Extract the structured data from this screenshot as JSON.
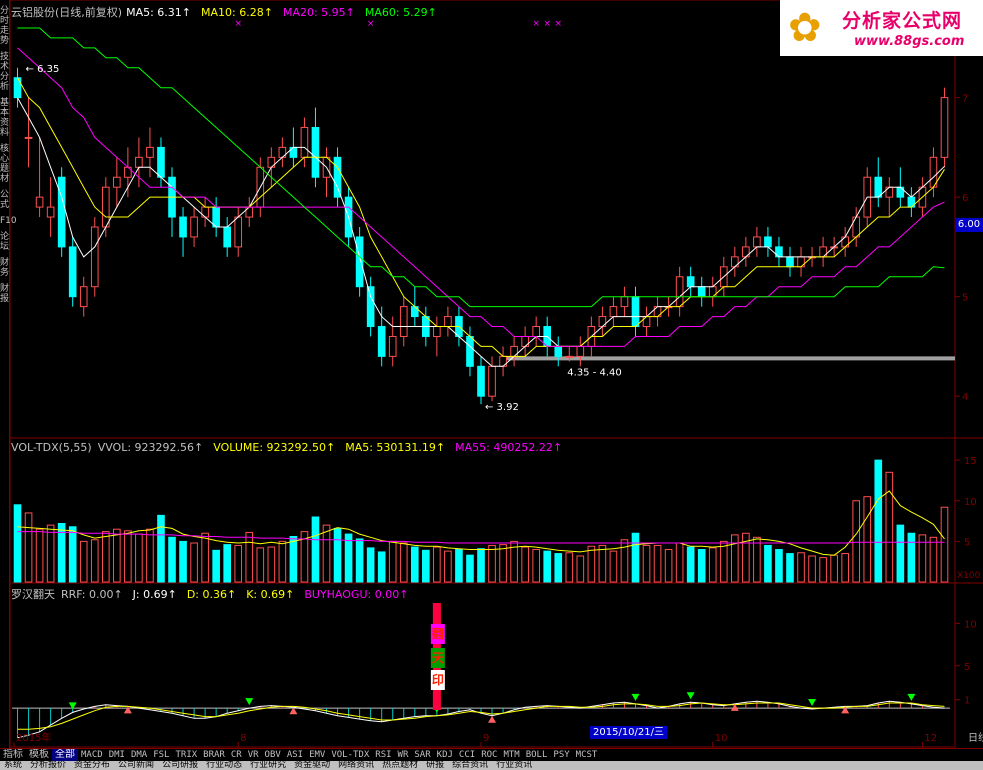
{
  "panels": {
    "main": {
      "stock_title": "云铝股份(日线,前复权)",
      "indicators": [
        {
          "label": "MA5: 6.31",
          "color": "#ffffff"
        },
        {
          "label": "MA10: 6.28",
          "color": "#ffff00"
        },
        {
          "label": "MA20: 5.95",
          "color": "#ff00ff"
        },
        {
          "label": "MA60: 5.29",
          "color": "#00ff00"
        }
      ],
      "price_tag": "6.00",
      "y_ticks": [
        "7",
        "6",
        "5",
        "4"
      ],
      "annotations": [
        "6.35",
        "3.92",
        "4.35 - 4.40"
      ]
    },
    "volume": {
      "name": "VOL-TDX(5,55)",
      "indicators": [
        {
          "label": "VVOL: 923292.56",
          "color": "#c0c0c0"
        },
        {
          "label": "VOLUME: 923292.50",
          "color": "#ffff00"
        },
        {
          "label": "MA5: 530131.19",
          "color": "#ffff00"
        },
        {
          "label": "MA55: 490252.22",
          "color": "#ff00ff"
        }
      ],
      "y_ticks": [
        "15",
        "10",
        "5"
      ],
      "unit": "X100"
    },
    "oscillator": {
      "name": "罗汉翻天",
      "indicators": [
        {
          "label": "RRF: 0.00",
          "color": "#c0c0c0"
        },
        {
          "label": "J: 0.69",
          "color": "#ffffff"
        },
        {
          "label": "D: 0.36",
          "color": "#ffff00"
        },
        {
          "label": "K: 0.69",
          "color": "#ffff00"
        },
        {
          "label": "BUYHAOGU: 0.00",
          "color": "#ff00ff"
        }
      ],
      "y_ticks": [
        "10",
        "5",
        "1"
      ],
      "signal_chars": [
        "翻",
        "天",
        "印"
      ]
    }
  },
  "x_axis_labels": [
    "2015年",
    "8",
    "9",
    "10",
    "12"
  ],
  "selected_date": "2015/10/21/三",
  "side_tabs": [
    "日线"
  ],
  "logo": {
    "name": "分析家公式网",
    "url": "www.88gs.com"
  },
  "tabs": [
    "指标",
    "模板",
    "全部",
    "MACD",
    "DMI",
    "DMA",
    "FSL",
    "TRIX",
    "BRAR",
    "CR",
    "VR",
    "OBV",
    "ASI",
    "EMV",
    "VOL-TDX",
    "RSI",
    "WR",
    "SAR",
    "KDJ",
    "CCI",
    "ROC",
    "MTM",
    "BOLL",
    "PSY",
    "MCST"
  ],
  "active_tab": "全部",
  "left_tabs": [
    "分时走势",
    "技术分析",
    "基本资料",
    "核心题材",
    "公式",
    "F10",
    "论坛",
    "财务",
    "财报"
  ],
  "bottom_items": [
    "系统",
    "分析报价",
    "资金分布",
    "公司新闻",
    "公司研报",
    "行业动态",
    "行业研究",
    "资金驱动",
    "网络资讯",
    "热点题材",
    "研报",
    "综合资讯",
    "行业资讯"
  ],
  "chart_data": {
    "type": "candlestick",
    "ylim": [
      3.6,
      7.8
    ],
    "x": [
      "2015-06",
      "",
      "",
      "",
      "",
      "",
      "",
      "",
      "",
      "",
      "",
      "",
      "",
      "",
      "",
      "",
      "",
      "",
      "",
      "",
      "",
      "",
      "",
      "",
      "",
      "",
      "",
      "",
      "",
      "",
      "",
      "",
      "",
      "",
      "",
      "",
      "",
      "",
      "",
      "",
      "",
      "",
      "",
      "",
      "",
      "",
      "",
      "",
      "",
      "",
      "",
      "",
      "",
      "",
      "",
      "",
      "",
      "",
      "",
      "",
      "",
      "",
      "",
      "",
      "",
      "",
      "",
      "",
      "",
      "",
      "",
      "",
      "",
      "",
      "",
      "",
      "",
      "",
      "",
      "",
      "",
      "",
      "",
      "",
      "",
      "",
      "",
      "",
      "",
      "",
      "",
      "",
      "",
      "",
      "",
      "",
      "",
      "",
      "",
      "",
      "2015-12"
    ],
    "ohlc": [
      [
        7.2,
        7.3,
        6.9,
        7.0
      ],
      [
        6.6,
        7.0,
        6.3,
        6.6
      ],
      [
        5.9,
        6.6,
        5.8,
        6.0
      ],
      [
        5.8,
        6.2,
        5.6,
        5.9
      ],
      [
        6.2,
        6.3,
        5.4,
        5.5
      ],
      [
        5.5,
        5.6,
        4.9,
        5.0
      ],
      [
        4.9,
        5.2,
        4.8,
        5.1
      ],
      [
        5.1,
        5.8,
        5.0,
        5.7
      ],
      [
        5.7,
        6.2,
        5.6,
        6.1
      ],
      [
        6.1,
        6.4,
        5.9,
        6.2
      ],
      [
        6.2,
        6.5,
        6.0,
        6.3
      ],
      [
        6.3,
        6.6,
        6.1,
        6.4
      ],
      [
        6.4,
        6.7,
        6.2,
        6.5
      ],
      [
        6.5,
        6.6,
        6.1,
        6.2
      ],
      [
        6.2,
        6.3,
        5.6,
        5.8
      ],
      [
        5.8,
        5.9,
        5.4,
        5.6
      ],
      [
        5.6,
        5.9,
        5.5,
        5.8
      ],
      [
        5.8,
        6.0,
        5.7,
        5.9
      ],
      [
        5.9,
        6.0,
        5.6,
        5.7
      ],
      [
        5.7,
        5.8,
        5.4,
        5.5
      ],
      [
        5.5,
        5.9,
        5.4,
        5.8
      ],
      [
        5.8,
        6.0,
        5.7,
        5.9
      ],
      [
        5.9,
        6.4,
        5.8,
        6.3
      ],
      [
        6.3,
        6.5,
        6.1,
        6.4
      ],
      [
        6.4,
        6.6,
        6.3,
        6.5
      ],
      [
        6.5,
        6.7,
        6.3,
        6.4
      ],
      [
        6.4,
        6.8,
        6.3,
        6.7
      ],
      [
        6.7,
        6.9,
        6.1,
        6.2
      ],
      [
        6.2,
        6.5,
        6.0,
        6.4
      ],
      [
        6.4,
        6.5,
        5.9,
        6.0
      ],
      [
        6.0,
        6.1,
        5.5,
        5.6
      ],
      [
        5.6,
        5.7,
        5.0,
        5.1
      ],
      [
        5.1,
        5.2,
        4.6,
        4.7
      ],
      [
        4.7,
        4.9,
        4.3,
        4.4
      ],
      [
        4.4,
        4.8,
        4.3,
        4.6
      ],
      [
        4.6,
        5.0,
        4.5,
        4.9
      ],
      [
        4.9,
        5.1,
        4.7,
        4.8
      ],
      [
        4.8,
        4.9,
        4.5,
        4.6
      ],
      [
        4.6,
        4.8,
        4.4,
        4.7
      ],
      [
        4.7,
        4.9,
        4.6,
        4.8
      ],
      [
        4.8,
        4.9,
        4.5,
        4.6
      ],
      [
        4.6,
        4.7,
        4.2,
        4.3
      ],
      [
        4.3,
        4.4,
        3.92,
        4.0
      ],
      [
        4.0,
        4.4,
        3.95,
        4.3
      ],
      [
        4.3,
        4.5,
        4.2,
        4.4
      ],
      [
        4.4,
        4.6,
        4.3,
        4.5
      ],
      [
        4.5,
        4.7,
        4.4,
        4.6
      ],
      [
        4.6,
        4.8,
        4.5,
        4.7
      ],
      [
        4.7,
        4.8,
        4.4,
        4.5
      ],
      [
        4.5,
        4.6,
        4.3,
        4.4
      ],
      [
        4.4,
        4.5,
        4.35,
        4.4
      ],
      [
        4.4,
        4.6,
        4.3,
        4.5
      ],
      [
        4.5,
        4.8,
        4.4,
        4.7
      ],
      [
        4.7,
        4.9,
        4.6,
        4.8
      ],
      [
        4.8,
        5.0,
        4.7,
        4.9
      ],
      [
        4.9,
        5.1,
        4.8,
        5.0
      ],
      [
        5.0,
        5.1,
        4.6,
        4.7
      ],
      [
        4.7,
        4.9,
        4.6,
        4.8
      ],
      [
        4.8,
        5.0,
        4.7,
        4.9
      ],
      [
        4.9,
        5.0,
        4.8,
        4.9
      ],
      [
        4.9,
        5.3,
        4.8,
        5.2
      ],
      [
        5.2,
        5.3,
        5.0,
        5.1
      ],
      [
        5.1,
        5.2,
        4.9,
        5.0
      ],
      [
        5.0,
        5.2,
        4.9,
        5.1
      ],
      [
        5.1,
        5.4,
        5.0,
        5.3
      ],
      [
        5.3,
        5.5,
        5.2,
        5.4
      ],
      [
        5.4,
        5.6,
        5.3,
        5.5
      ],
      [
        5.5,
        5.7,
        5.4,
        5.6
      ],
      [
        5.6,
        5.7,
        5.4,
        5.5
      ],
      [
        5.5,
        5.6,
        5.3,
        5.4
      ],
      [
        5.4,
        5.5,
        5.2,
        5.3
      ],
      [
        5.3,
        5.5,
        5.2,
        5.4
      ],
      [
        5.4,
        5.5,
        5.3,
        5.4
      ],
      [
        5.4,
        5.6,
        5.3,
        5.5
      ],
      [
        5.5,
        5.6,
        5.4,
        5.5
      ],
      [
        5.5,
        5.7,
        5.4,
        5.6
      ],
      [
        5.6,
        5.9,
        5.5,
        5.8
      ],
      [
        5.8,
        6.3,
        5.7,
        6.2
      ],
      [
        6.2,
        6.4,
        5.9,
        6.0
      ],
      [
        6.0,
        6.2,
        5.8,
        6.1
      ],
      [
        6.1,
        6.3,
        5.9,
        6.0
      ],
      [
        6.0,
        6.1,
        5.8,
        5.9
      ],
      [
        5.9,
        6.2,
        5.8,
        6.1
      ],
      [
        6.1,
        6.5,
        6.0,
        6.4
      ],
      [
        6.4,
        7.1,
        6.3,
        7.0
      ]
    ],
    "ma5": [
      7.0,
      6.8,
      6.6,
      6.3,
      6.0,
      5.6,
      5.4,
      5.5,
      5.7,
      5.9,
      6.1,
      6.3,
      6.3,
      6.2,
      6.1,
      6.0,
      5.9,
      5.8,
      5.7,
      5.7,
      5.8,
      5.9,
      6.1,
      6.3,
      6.4,
      6.5,
      6.5,
      6.4,
      6.3,
      6.1,
      5.8,
      5.4,
      5.0,
      4.8,
      4.7,
      4.7,
      4.7,
      4.7,
      4.7,
      4.7,
      4.6,
      4.5,
      4.4,
      4.3,
      4.3,
      4.4,
      4.5,
      4.6,
      4.6,
      4.5,
      4.5,
      4.5,
      4.6,
      4.7,
      4.8,
      4.8,
      4.8,
      4.8,
      4.9,
      4.9,
      5.0,
      5.1,
      5.1,
      5.1,
      5.2,
      5.3,
      5.4,
      5.5,
      5.5,
      5.4,
      5.4,
      5.4,
      5.4,
      5.4,
      5.5,
      5.6,
      5.8,
      6.0,
      6.0,
      6.1,
      6.1,
      6.0,
      6.1,
      6.2,
      6.31
    ],
    "ma10": [
      7.2,
      7.0,
      6.9,
      6.7,
      6.5,
      6.3,
      6.1,
      5.9,
      5.8,
      5.8,
      5.8,
      5.9,
      6.0,
      6.0,
      6.0,
      6.0,
      6.0,
      5.9,
      5.9,
      5.9,
      5.9,
      5.9,
      6.0,
      6.1,
      6.2,
      6.3,
      6.4,
      6.4,
      6.4,
      6.3,
      6.1,
      5.9,
      5.6,
      5.4,
      5.2,
      5.0,
      4.9,
      4.8,
      4.7,
      4.7,
      4.7,
      4.6,
      4.5,
      4.5,
      4.4,
      4.4,
      4.4,
      4.5,
      4.5,
      4.5,
      4.5,
      4.5,
      4.6,
      4.6,
      4.7,
      4.7,
      4.7,
      4.8,
      4.8,
      4.9,
      4.9,
      5.0,
      5.0,
      5.0,
      5.1,
      5.1,
      5.2,
      5.3,
      5.3,
      5.3,
      5.3,
      5.3,
      5.4,
      5.4,
      5.4,
      5.5,
      5.6,
      5.7,
      5.8,
      5.8,
      5.9,
      5.9,
      6.0,
      6.1,
      6.28
    ],
    "ma20": [
      7.5,
      7.4,
      7.3,
      7.2,
      7.1,
      6.9,
      6.8,
      6.6,
      6.5,
      6.4,
      6.3,
      6.2,
      6.1,
      6.1,
      6.1,
      6.0,
      6.0,
      6.0,
      5.9,
      5.9,
      5.9,
      5.9,
      5.9,
      5.9,
      5.9,
      5.9,
      5.9,
      5.9,
      5.9,
      5.9,
      5.9,
      5.8,
      5.7,
      5.6,
      5.5,
      5.4,
      5.3,
      5.2,
      5.1,
      5.0,
      4.9,
      4.8,
      4.8,
      4.7,
      4.7,
      4.6,
      4.6,
      4.6,
      4.5,
      4.5,
      4.5,
      4.5,
      4.5,
      4.5,
      4.5,
      4.5,
      4.6,
      4.6,
      4.6,
      4.6,
      4.7,
      4.7,
      4.7,
      4.8,
      4.8,
      4.9,
      4.9,
      5.0,
      5.0,
      5.1,
      5.1,
      5.1,
      5.2,
      5.2,
      5.2,
      5.3,
      5.3,
      5.4,
      5.5,
      5.5,
      5.6,
      5.7,
      5.8,
      5.9,
      5.95
    ],
    "ma60": [
      7.7,
      7.7,
      7.7,
      7.6,
      7.6,
      7.6,
      7.5,
      7.5,
      7.4,
      7.4,
      7.3,
      7.3,
      7.2,
      7.1,
      7.1,
      7.0,
      6.9,
      6.8,
      6.7,
      6.6,
      6.5,
      6.4,
      6.3,
      6.2,
      6.1,
      6.0,
      5.9,
      5.8,
      5.7,
      5.6,
      5.5,
      5.4,
      5.3,
      5.3,
      5.2,
      5.2,
      5.1,
      5.1,
      5.0,
      5.0,
      5.0,
      4.9,
      4.9,
      4.9,
      4.9,
      4.9,
      4.9,
      4.9,
      4.9,
      4.9,
      4.9,
      4.9,
      4.9,
      5.0,
      5.0,
      5.0,
      5.0,
      5.0,
      5.0,
      5.0,
      5.0,
      5.0,
      5.0,
      5.0,
      5.0,
      5.0,
      5.0,
      5.0,
      5.0,
      5.0,
      5.0,
      5.0,
      5.0,
      5.0,
      5.0,
      5.1,
      5.1,
      5.1,
      5.1,
      5.2,
      5.2,
      5.2,
      5.2,
      5.3,
      5.29
    ],
    "support_level": 4.38,
    "volume": [
      9.5,
      8.5,
      6.5,
      7.0,
      7.2,
      6.8,
      5.0,
      5.2,
      6.2,
      6.5,
      6.3,
      5.9,
      6.5,
      8.2,
      5.5,
      5.0,
      4.8,
      6.0,
      3.9,
      4.6,
      4.5,
      6.1,
      4.2,
      4.3,
      5.0,
      5.6,
      6.2,
      8.0,
      7.0,
      6.6,
      5.9,
      5.3,
      4.2,
      3.7,
      5.0,
      4.8,
      4.3,
      3.9,
      4.3,
      3.8,
      4.0,
      3.3,
      4.1,
      4.5,
      4.6,
      5.0,
      4.3,
      4.0,
      3.8,
      3.5,
      3.6,
      3.2,
      4.4,
      4.5,
      3.8,
      5.2,
      6.0,
      4.5,
      4.5,
      4.0,
      4.8,
      4.3,
      4.0,
      4.2,
      5.0,
      5.8,
      6.0,
      5.5,
      4.5,
      4.0,
      3.5,
      3.6,
      3.2,
      3.0,
      3.3,
      3.5,
      10.0,
      10.5,
      15.0,
      13.5,
      7.0,
      6.0,
      5.8,
      5.5,
      9.2
    ],
    "vol_ma5": [
      6.8,
      6.7,
      6.6,
      6.5,
      6.4,
      6.3,
      5.8,
      5.4,
      5.6,
      5.8,
      6.0,
      6.3,
      6.4,
      6.8,
      6.6,
      5.9,
      5.6,
      5.4,
      5.1,
      4.9,
      4.8,
      4.9,
      4.7,
      4.9,
      4.7,
      5.0,
      5.3,
      5.7,
      6.2,
      6.7,
      6.5,
      5.9,
      5.5,
      5.1,
      4.9,
      4.7,
      4.5,
      4.4,
      4.4,
      4.2,
      4.1,
      4.0,
      4.0,
      4.0,
      4.1,
      4.3,
      4.4,
      4.3,
      4.1,
      3.9,
      3.8,
      3.7,
      3.9,
      4.0,
      4.1,
      4.3,
      4.6,
      4.7,
      4.8,
      4.8,
      4.8,
      4.4,
      4.4,
      4.3,
      4.4,
      4.7,
      5.0,
      5.3,
      5.2,
      5.0,
      4.7,
      4.2,
      3.8,
      3.4,
      3.3,
      4.3,
      5.9,
      8.0,
      10.2,
      11.2,
      9.4,
      8.6,
      7.9,
      7.1,
      5.3
    ],
    "vol_ma55": [
      6.2,
      6.2,
      6.2,
      6.1,
      6.1,
      6.1,
      6.0,
      6.0,
      6.0,
      5.9,
      5.9,
      5.9,
      5.8,
      5.8,
      5.8,
      5.7,
      5.7,
      5.6,
      5.6,
      5.5,
      5.5,
      5.5,
      5.4,
      5.4,
      5.4,
      5.3,
      5.3,
      5.2,
      5.2,
      5.2,
      5.1,
      5.1,
      5.1,
      5.0,
      5.0,
      5.0,
      4.9,
      4.9,
      4.9,
      4.8,
      4.8,
      4.8,
      4.8,
      4.8,
      4.8,
      4.8,
      4.8,
      4.8,
      4.8,
      4.8,
      4.8,
      4.8,
      4.8,
      4.8,
      4.8,
      4.8,
      4.8,
      4.8,
      4.8,
      4.8,
      4.8,
      4.8,
      4.8,
      4.8,
      4.8,
      4.8,
      4.8,
      4.8,
      4.8,
      4.8,
      4.8,
      4.8,
      4.8,
      4.8,
      4.8,
      4.8,
      4.9,
      4.9,
      4.9,
      4.9,
      4.9,
      4.9,
      4.9,
      4.9,
      4.9
    ],
    "vol_ylim": [
      0,
      16
    ],
    "osc_k": [
      -3.5,
      -3.2,
      -2.8,
      -2.0,
      -1.2,
      -0.5,
      -0.1,
      0.2,
      0.4,
      0.3,
      0.2,
      0.0,
      -0.2,
      -0.4,
      -0.6,
      -0.9,
      -1.2,
      -1.2,
      -1.0,
      -0.6,
      -0.3,
      0.0,
      0.2,
      0.3,
      0.2,
      0.1,
      -0.1,
      -0.3,
      -0.6,
      -0.9,
      -1.1,
      -1.3,
      -1.5,
      -1.6,
      -1.4,
      -1.2,
      -1.0,
      -0.9,
      -0.9,
      -0.7,
      -0.4,
      -0.2,
      -0.6,
      -0.9,
      -0.6,
      -0.2,
      0.1,
      0.2,
      0.3,
      0.2,
      0.1,
      0.0,
      0.2,
      0.4,
      0.6,
      0.7,
      0.5,
      0.3,
      0.0,
      0.2,
      0.5,
      0.7,
      0.6,
      0.4,
      0.3,
      0.5,
      0.7,
      0.8,
      0.7,
      0.5,
      0.2,
      0.0,
      -0.1,
      0.0,
      0.1,
      0.2,
      0.2,
      0.3,
      0.6,
      0.8,
      0.7,
      0.5,
      0.3,
      0.1,
      0.0
    ],
    "osc_d": [
      -2.5,
      -2.5,
      -2.4,
      -2.2,
      -1.8,
      -1.3,
      -0.8,
      -0.3,
      0.1,
      0.2,
      0.2,
      0.1,
      0.0,
      -0.2,
      -0.4,
      -0.6,
      -0.8,
      -1.0,
      -1.0,
      -0.8,
      -0.6,
      -0.3,
      -0.1,
      0.1,
      0.2,
      0.2,
      0.1,
      -0.1,
      -0.3,
      -0.6,
      -0.8,
      -1.0,
      -1.2,
      -1.4,
      -1.4,
      -1.3,
      -1.2,
      -1.0,
      -0.9,
      -0.8,
      -0.6,
      -0.4,
      -0.5,
      -0.7,
      -0.6,
      -0.4,
      -0.2,
      0.0,
      0.2,
      0.2,
      0.2,
      0.1,
      0.1,
      0.2,
      0.4,
      0.5,
      0.5,
      0.4,
      0.2,
      0.2,
      0.3,
      0.5,
      0.6,
      0.5,
      0.4,
      0.4,
      0.5,
      0.6,
      0.6,
      0.6,
      0.4,
      0.2,
      0.0,
      0.0,
      0.0,
      0.1,
      0.2,
      0.2,
      0.4,
      0.6,
      0.6,
      0.6,
      0.4,
      0.3,
      0.2
    ],
    "osc_ylim": [
      -4,
      13
    ],
    "osc_buy_up": [
      10,
      25,
      43,
      65,
      75,
      85
    ],
    "osc_buy_down": [
      5,
      21,
      38,
      56,
      61,
      72,
      81
    ],
    "osc_signal_index": 38
  }
}
